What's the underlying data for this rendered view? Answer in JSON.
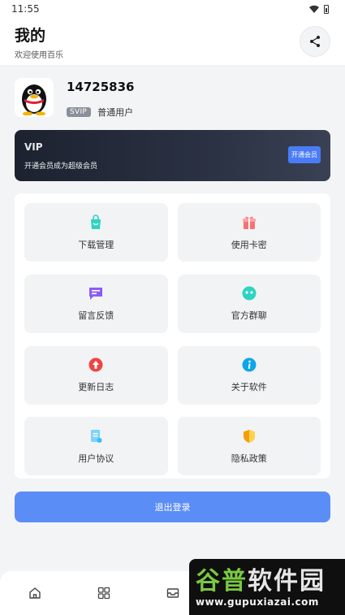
{
  "status_bar": {
    "time": "11:55"
  },
  "header": {
    "title": "我的",
    "subtitle": "欢迎使用百乐",
    "share_icon": "share-icon"
  },
  "profile": {
    "user_id": "14725836",
    "badge": "SVIP",
    "level": "普通用户"
  },
  "vip_card": {
    "title": "VIP",
    "description": "开通会员成为超级会员",
    "button": "开通会员"
  },
  "grid": [
    {
      "label": "下载管理",
      "icon": "shopping-bag-icon",
      "color": "#2dd4bf"
    },
    {
      "label": "使用卡密",
      "icon": "gift-icon",
      "color": "#f87171"
    },
    {
      "label": "留言反馈",
      "icon": "message-icon",
      "color": "#8b5cf6"
    },
    {
      "label": "官方群聊",
      "icon": "chat-icon",
      "color": "#2dd4bf"
    },
    {
      "label": "更新日志",
      "icon": "upload-icon",
      "color": "#ef4444"
    },
    {
      "label": "关于软件",
      "icon": "info-icon",
      "color": "#0ea5e9"
    },
    {
      "label": "用户协议",
      "icon": "document-icon",
      "color": "#38bdf8"
    },
    {
      "label": "隐私政策",
      "icon": "shield-icon",
      "color": "#f59e0b"
    }
  ],
  "logout": {
    "label": "退出登录"
  },
  "tabs": [
    {
      "icon": "home-icon"
    },
    {
      "icon": "apps-icon"
    },
    {
      "icon": "mail-icon"
    },
    {
      "icon": "user-icon"
    }
  ],
  "watermark": {
    "title_part1": "谷普",
    "title_part2": "软件园",
    "url": "www.gupuxiazai.com"
  }
}
